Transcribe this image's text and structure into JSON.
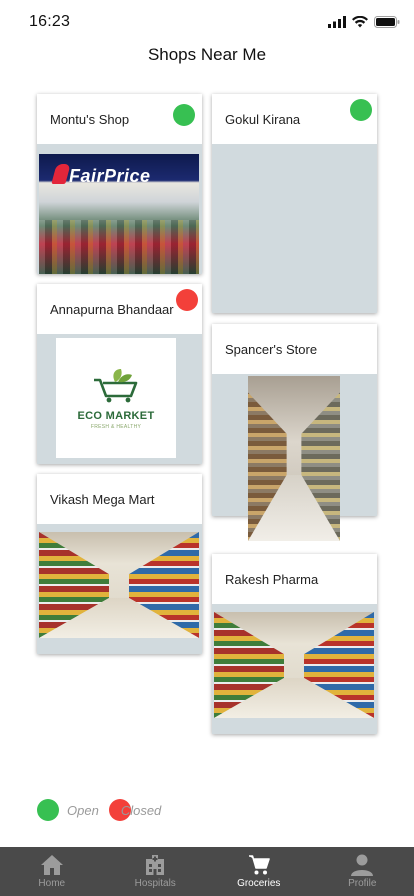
{
  "status_bar": {
    "time": "16:23"
  },
  "page": {
    "title": "Shops Near Me"
  },
  "colors": {
    "open": "#37c052",
    "closed": "#f3403a",
    "tab_bar": "#4a4a4a"
  },
  "shops": [
    {
      "name": "Montu's Shop",
      "status": "open",
      "image": "fairprice-store-photo",
      "image_text": "FairPrice"
    },
    {
      "name": "Gokul Kirana",
      "status": "open",
      "image": "none"
    },
    {
      "name": "Annapurna Bhandaar",
      "status": "closed",
      "image": "eco-market-logo",
      "logo_text": "ECO MARKET",
      "logo_subtext": "FRESH & HEALTHY"
    },
    {
      "name": "Spancer's Store",
      "status": "none",
      "image": "store-aisle-photo"
    },
    {
      "name": "Vikash Mega Mart",
      "status": "none",
      "image": "grocery-aisle-photo"
    },
    {
      "name": "Rakesh Pharma",
      "status": "none",
      "image": "grocery-aisle-photo"
    }
  ],
  "legend": {
    "open_label": "Open",
    "closed_label": "Closed"
  },
  "tabs": [
    {
      "label": "Home",
      "icon": "home-icon",
      "active": false
    },
    {
      "label": "Hospitals",
      "icon": "hospital-icon",
      "active": false
    },
    {
      "label": "Groceries",
      "icon": "cart-icon",
      "active": true
    },
    {
      "label": "Profile",
      "icon": "person-icon",
      "active": false
    }
  ]
}
